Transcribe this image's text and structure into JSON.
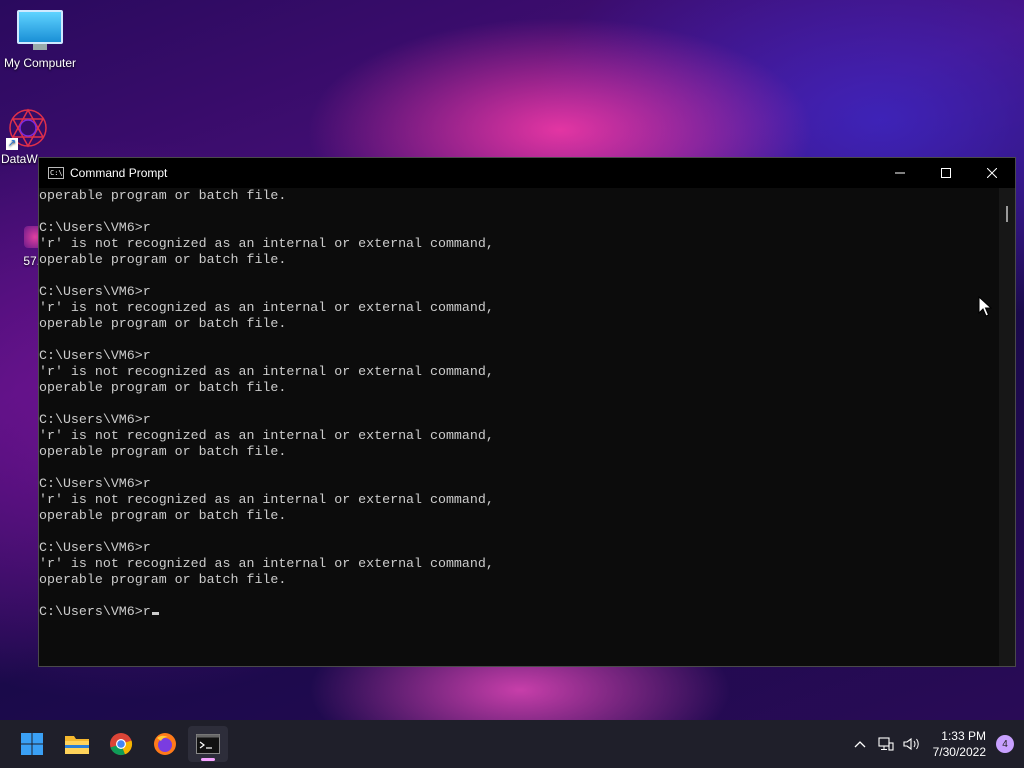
{
  "desktop": {
    "icons": [
      {
        "label": "My Computer",
        "icon": "monitor-icon"
      },
      {
        "label": "DataW",
        "icon": "datawrapper-icon"
      },
      {
        "label": "57.",
        "icon": "app-icon"
      }
    ]
  },
  "cmd": {
    "title": "Command Prompt",
    "lines": [
      "operable program or batch file.",
      "",
      "C:\\Users\\VM6>r",
      "'r' is not recognized as an internal or external command,",
      "operable program or batch file.",
      "",
      "C:\\Users\\VM6>r",
      "'r' is not recognized as an internal or external command,",
      "operable program or batch file.",
      "",
      "C:\\Users\\VM6>r",
      "'r' is not recognized as an internal or external command,",
      "operable program or batch file.",
      "",
      "C:\\Users\\VM6>r",
      "'r' is not recognized as an internal or external command,",
      "operable program or batch file.",
      "",
      "C:\\Users\\VM6>r",
      "'r' is not recognized as an internal or external command,",
      "operable program or batch file.",
      "",
      "C:\\Users\\VM6>r",
      "'r' is not recognized as an internal or external command,",
      "operable program or batch file.",
      "",
      "C:\\Users\\VM6>r"
    ],
    "controls": {
      "minimize": "—",
      "maximize": "☐",
      "close": "✕"
    }
  },
  "taskbar": {
    "apps": [
      {
        "name": "start-button",
        "icon": "windows-icon"
      },
      {
        "name": "file-explorer-button",
        "icon": "folder-icon"
      },
      {
        "name": "chrome-button",
        "icon": "chrome-icon"
      },
      {
        "name": "firefox-button",
        "icon": "firefox-icon"
      },
      {
        "name": "command-prompt-taskbar-button",
        "icon": "terminal-icon",
        "active": true
      }
    ],
    "tray": {
      "time": "1:33 PM",
      "date": "7/30/2022",
      "notification_count": "4"
    }
  },
  "colors": {
    "console_bg": "#0c0c0c",
    "console_text": "#cccccc",
    "taskbar_bg": "#1f1f2a",
    "badge": "#c8a0ff"
  }
}
